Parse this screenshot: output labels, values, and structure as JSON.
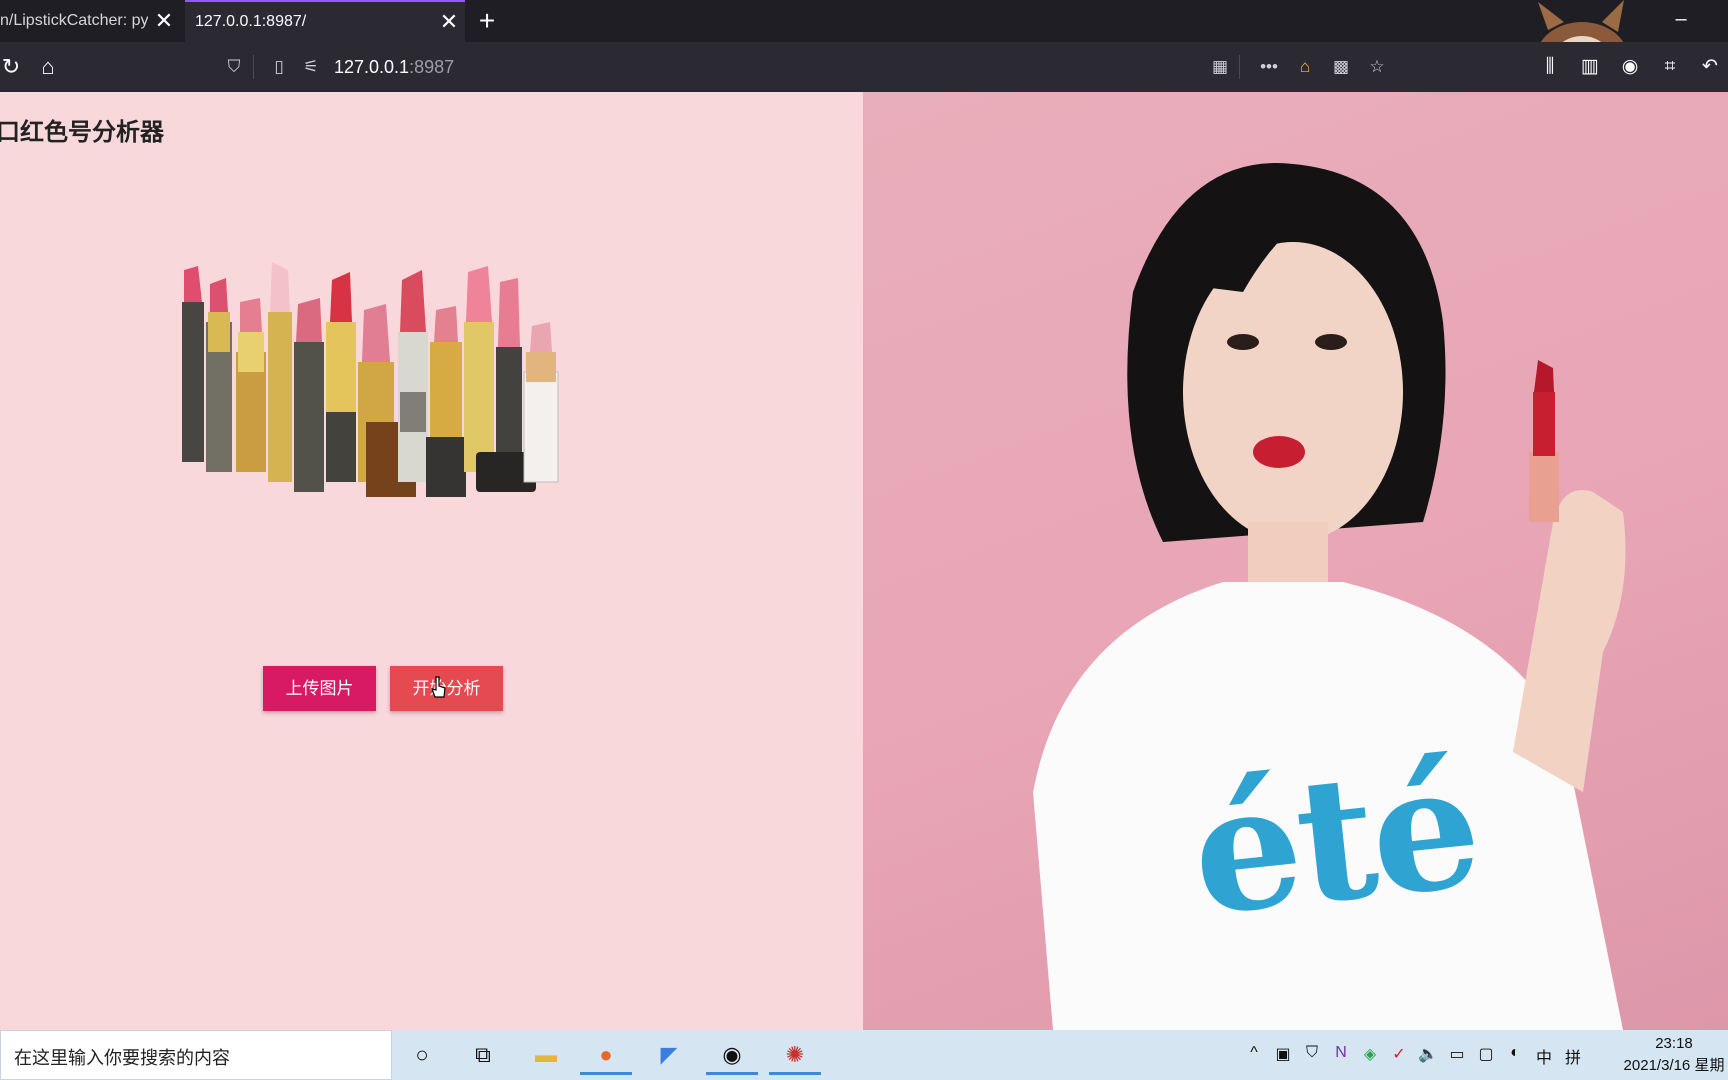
{
  "browser": {
    "tabs": [
      {
        "title": "n/LipstickCatcher: py",
        "active": false
      },
      {
        "title": "127.0.0.1:8987/",
        "active": true
      }
    ],
    "new_tab_label": "+",
    "minimize_label": "–",
    "url_host": "127.0.0.1",
    "url_port": ":8987"
  },
  "page": {
    "title": "口红色号分析器",
    "buttons": {
      "upload": "上传图片",
      "analyze": "开始分析"
    },
    "shirt_text": "été",
    "colors": {
      "left_bg": "#f9d8dc",
      "right_bg": "#e9aebb",
      "upload_btn": "#d81a63",
      "analyze_btn": "#e54a50"
    }
  },
  "taskbar": {
    "search_placeholder": "在这里输入你要搜索的内容",
    "tray_ime_lang": "中",
    "tray_ime_mode": "拼",
    "clock_time": "23:18",
    "clock_date": "2021/3/16 星期"
  }
}
